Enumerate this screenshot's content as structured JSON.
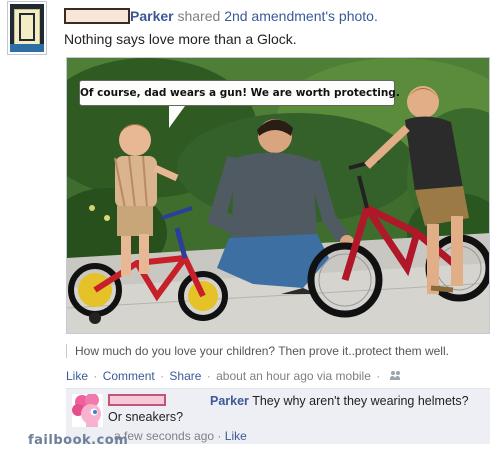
{
  "post": {
    "author": "Parker",
    "shared_text": "shared",
    "source_link": "2nd amendment's photo.",
    "message": "Nothing says love more than a Glock."
  },
  "photo": {
    "caption_text": "Of course, dad wears a gun! We are worth protecting.",
    "description": "How much do you love your children? Then prove it..protect them well."
  },
  "actions": {
    "like": "Like",
    "comment": "Comment",
    "share": "Share",
    "timestamp": "about an hour ago via mobile",
    "separator": "·",
    "audience_icon": "people-icon"
  },
  "comment": {
    "author": "Parker",
    "text": "They why aren't they wearing helmets? Or sneakers?",
    "timestamp": "a few seconds ago",
    "like": "Like",
    "separator": "·"
  },
  "watermark": "failbook.com",
  "colors": {
    "link_blue": "#3b5998",
    "comment_bg": "#edeff4",
    "meta_grey": "#808080"
  }
}
